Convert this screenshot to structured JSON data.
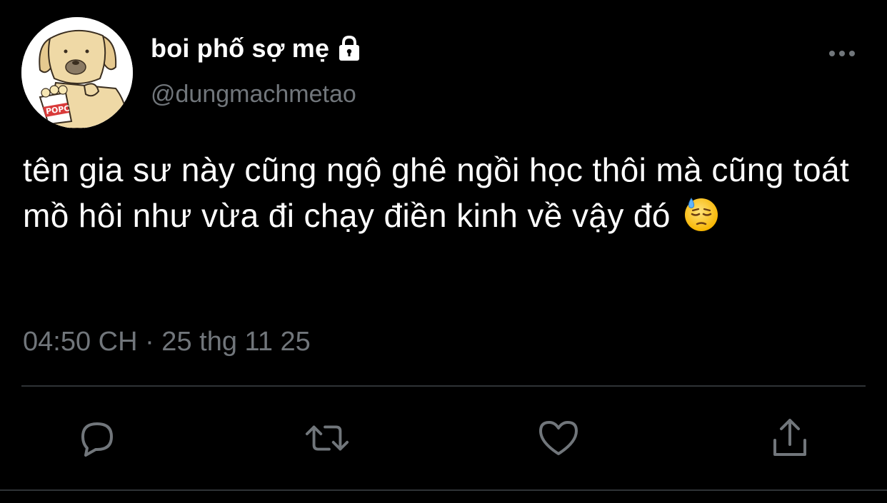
{
  "tweet": {
    "display_name": "boi phố sợ mẹ",
    "handle": "@dungmachmetao",
    "text": "tên gia sư này cũng ngộ ghê ngồi học thôi mà cũng toát mồ hôi như vừa đi chạy điền kinh về vậy đó",
    "timestamp": "04:50 CH · 25 thg 11 25",
    "avatar_label": "POPC",
    "protected": true
  },
  "icons": {
    "lock": "lock-icon",
    "more": "more-options-icon",
    "emoji": "downcast-face-with-sweat-emoji",
    "reply": "reply-icon",
    "retweet": "retweet-icon",
    "like": "heart-icon",
    "share": "share-icon"
  },
  "colors": {
    "background": "#000000",
    "text": "#ffffff",
    "secondary_text": "#71767b",
    "icon": "#71767b",
    "divider": "#2f3336"
  }
}
